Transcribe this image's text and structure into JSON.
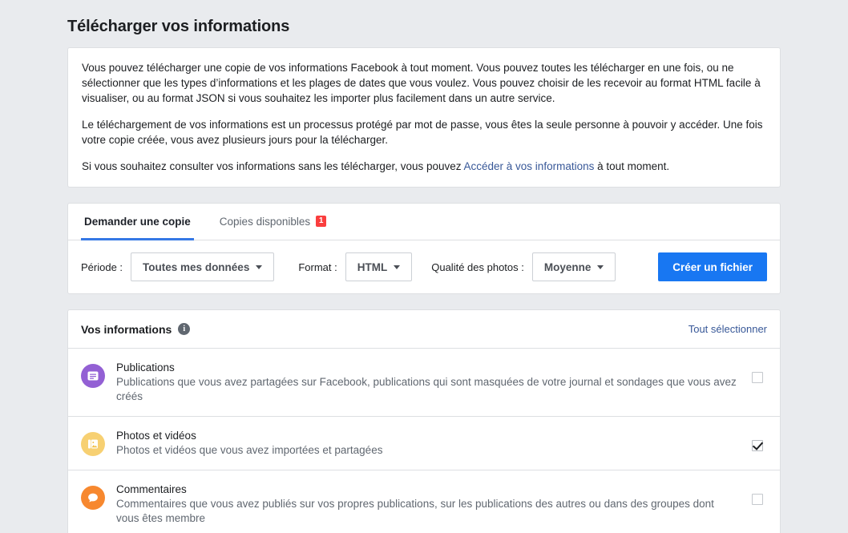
{
  "page": {
    "title": "Télécharger vos informations"
  },
  "intro": {
    "paragraph1": "Vous pouvez télécharger une copie de vos informations Facebook à tout moment. Vous pouvez toutes les télécharger en une fois, ou ne sélectionner que les types d’informations et les plages de dates que vous voulez. Vous pouvez choisir de les recevoir au format HTML facile à visualiser, ou au format JSON si vous souhaitez les importer plus facilement dans un autre service.",
    "paragraph2": "Le téléchargement de vos informations est un processus protégé par mot de passe, vous êtes la seule personne à pouvoir y accéder. Une fois votre copie créée, vous avez plusieurs jours pour la télécharger.",
    "paragraph3_before": "Si vous souhaitez consulter vos informations sans les télécharger, vous pouvez ",
    "paragraph3_link": "Accéder à vos informations",
    "paragraph3_after": " à tout moment.",
    "link_color": "#385898"
  },
  "tabs": [
    {
      "label": "Demander une copie",
      "active": true,
      "badge": ""
    },
    {
      "label": "Copies disponibles",
      "active": false,
      "badge": "1"
    }
  ],
  "filters": {
    "period_label": "Période :",
    "period_value": "Toutes mes données",
    "format_label": "Format :",
    "format_value": "HTML",
    "quality_label": "Qualité des photos :",
    "quality_value": "Moyenne",
    "create_button": "Créer un fichier",
    "create_button_color": "#1877f2"
  },
  "info_section": {
    "title": "Vos informations",
    "info_icon": "i",
    "select_all": "Tout sélectionner",
    "items": [
      {
        "icon": "post-icon",
        "icon_color": "#9360d4",
        "title": "Publications",
        "description": "Publications que vous avez partagées sur Facebook, publications qui sont masquées de votre journal et sondages que vous avez créés",
        "checked": false
      },
      {
        "icon": "photo-icon",
        "icon_color": "#f7d072",
        "title": "Photos et vidéos",
        "description": "Photos et vidéos que vous avez importées et partagées",
        "checked": true
      },
      {
        "icon": "comment-icon",
        "icon_color": "#f7882f",
        "title": "Commentaires",
        "description": "Commentaires que vous avez publiés sur vos propres publications, sur les publications des autres ou dans des groupes dont vous êtes membre",
        "checked": false
      }
    ]
  }
}
